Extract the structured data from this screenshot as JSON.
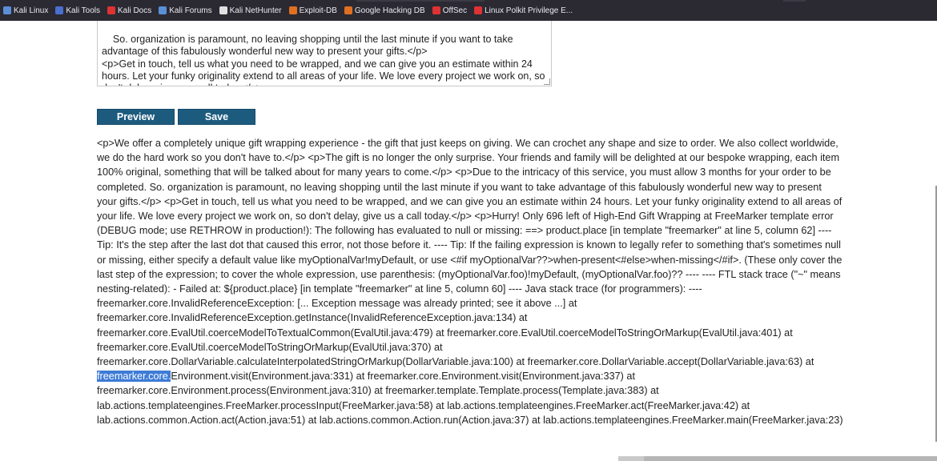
{
  "bookmarks": [
    {
      "label": "Kali Linux",
      "icon": "kali-dragon-icon",
      "color": "#5a8fd8"
    },
    {
      "label": "Kali Tools",
      "icon": "kali-tools-icon",
      "color": "#4a6fd0"
    },
    {
      "label": "Kali Docs",
      "icon": "kali-docs-icon",
      "color": "#d33"
    },
    {
      "label": "Kali Forums",
      "icon": "kali-forums-icon",
      "color": "#5a8fd8"
    },
    {
      "label": "Kali NetHunter",
      "icon": "nethunter-icon",
      "color": "#e0e0e0"
    },
    {
      "label": "Exploit-DB",
      "icon": "exploit-db-icon",
      "color": "#e07020"
    },
    {
      "label": "Google Hacking DB",
      "icon": "ghdb-icon",
      "color": "#e07020"
    },
    {
      "label": "OffSec",
      "icon": "offsec-icon",
      "color": "#d33"
    },
    {
      "label": "Linux Polkit Privilege E...",
      "icon": "polkit-icon",
      "color": "#d33"
    }
  ],
  "editor": {
    "text": "So. organization is paramount, no leaving shopping until the last minute if you want to take advantage of this fabulously wonderful new way to present your gifts.</p>\n<p>Get in touch, tell us what you need to be wrapped, and we can give you an estimate within 24 hours. Let your funky originality extend to all areas of your life. We love every project we work on, so don't delay, give us a call today.</p>\n<p>Hurry! Only ${product.stock} left of ${product.name} at ${product.place}.</p>"
  },
  "buttons": {
    "preview": "Preview",
    "save": "Save"
  },
  "output": {
    "before_highlight": "<p>We offer a completely unique gift wrapping experience - the gift that just keeps on giving. We can crochet any shape and size to order. We also collect worldwide, we do the hard work so you don't have to.</p> <p>The gift is no longer the only surprise. Your friends and family will be delighted at our bespoke wrapping, each item 100% original, something that will be talked about for many years to come.</p> <p>Due to the intricacy of this service, you must allow 3 months for your order to be completed. So. organization is paramount, no leaving shopping until the last minute if you want to take advantage of this fabulously wonderful new way to present your gifts.</p> <p>Get in touch, tell us what you need to be wrapped, and we can give you an estimate within 24 hours. Let your funky originality extend to all areas of your life. We love every project we work on, so don't delay, give us a call today.</p> <p>Hurry! Only 696 left of High-End Gift Wrapping at FreeMarker template error (DEBUG mode; use RETHROW in production!): The following has evaluated to null or missing: ==> product.place [in template \"freemarker\" at line 5, column 62] ---- Tip: It's the step after the last dot that caused this error, not those before it. ---- Tip: If the failing expression is known to legally refer to something that's sometimes null or missing, either specify a default value like myOptionalVar!myDefault, or use <#if myOptionalVar??>when-present<#else>when-missing</#if>. (These only cover the last step of the expression; to cover the whole expression, use parenthesis: (myOptionalVar.foo)!myDefault, (myOptionalVar.foo)?? ---- ---- FTL stack trace (\"~\" means nesting-related): - Failed at: ${product.place} [in template \"freemarker\" at line 5, column 60] ---- Java stack trace (for programmers): ---- freemarker.core.InvalidReferenceException: [... Exception message was already printed; see it above ...] at freemarker.core.InvalidReferenceException.getInstance(InvalidReferenceException.java:134) at freemarker.core.EvalUtil.coerceModelToTextualCommon(EvalUtil.java:479) at freemarker.core.EvalUtil.coerceModelToStringOrMarkup(EvalUtil.java:401) at freemarker.core.EvalUtil.coerceModelToStringOrMarkup(EvalUtil.java:370) at freemarker.core.DollarVariable.calculateInterpolatedStringOrMarkup(DollarVariable.java:100) at freemarker.core.DollarVariable.accept(DollarVariable.java:63) at ",
    "highlight": "freemarker.core.",
    "after_highlight": "Environment.visit(Environment.java:331) at freemarker.core.Environment.visit(Environment.java:337) at freemarker.core.Environment.process(Environment.java:310) at freemarker.template.Template.process(Template.java:383) at lab.actions.templateengines.FreeMarker.processInput(FreeMarker.java:58) at lab.actions.templateengines.FreeMarker.act(FreeMarker.java:42) at lab.actions.common.Action.act(Action.java:51) at lab.actions.common.Action.run(Action.java:37) at lab.actions.templateengines.FreeMarker.main(FreeMarker.java:23)"
  }
}
